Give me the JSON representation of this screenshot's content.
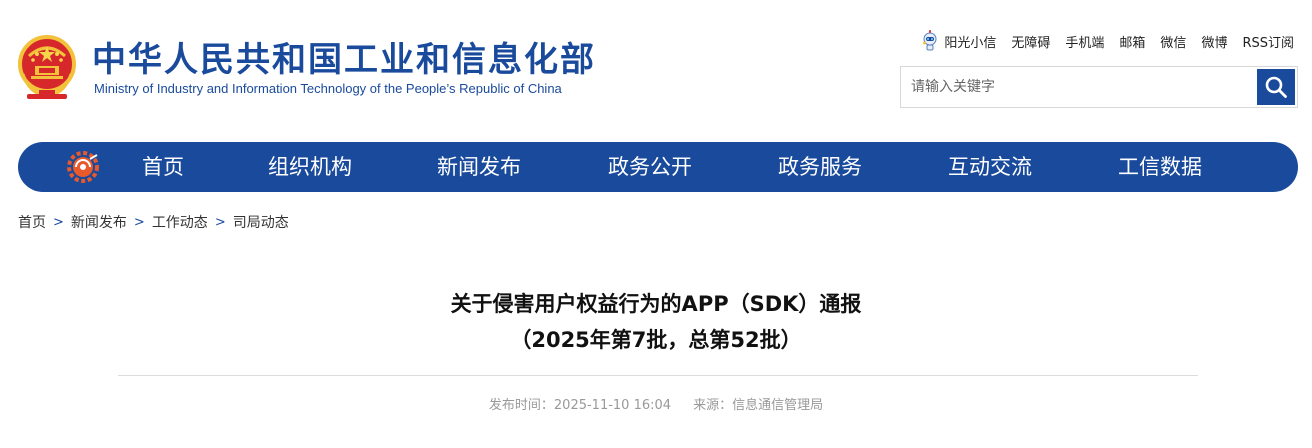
{
  "header": {
    "title_cn": "中华人民共和国工业和信息化部",
    "title_en": "Ministry of Industry and Information Technology of the People’s Republic of China",
    "brand_color": "#1a4a9c",
    "emblem_icon": "national-emblem-icon"
  },
  "toplinks": [
    {
      "label": "阳光小信",
      "icon": "robot-mascot-icon"
    },
    {
      "label": "无障碍"
    },
    {
      "label": "手机端"
    },
    {
      "label": "邮箱"
    },
    {
      "label": "微信"
    },
    {
      "label": "微博"
    },
    {
      "label": "RSS订阅"
    }
  ],
  "search": {
    "placeholder": "请输入关键字",
    "value": "",
    "button_icon": "search-icon"
  },
  "nav": {
    "logo_icon": "miit-gear-logo-icon",
    "items": [
      "首页",
      "组织机构",
      "新闻发布",
      "政务公开",
      "政务服务",
      "互动交流",
      "工信数据"
    ]
  },
  "breadcrumb": [
    "首页",
    "新闻发布",
    "工作动态",
    "司局动态"
  ],
  "article": {
    "title_line1": "关于侵害用户权益行为的APP（SDK）通报",
    "title_line2": "（2025年第7批，总第52批）",
    "publish_label": "发布时间：",
    "publish_time": "2025-11-10 16:04",
    "source_label": "来源：",
    "source": "信息通信管理局"
  }
}
